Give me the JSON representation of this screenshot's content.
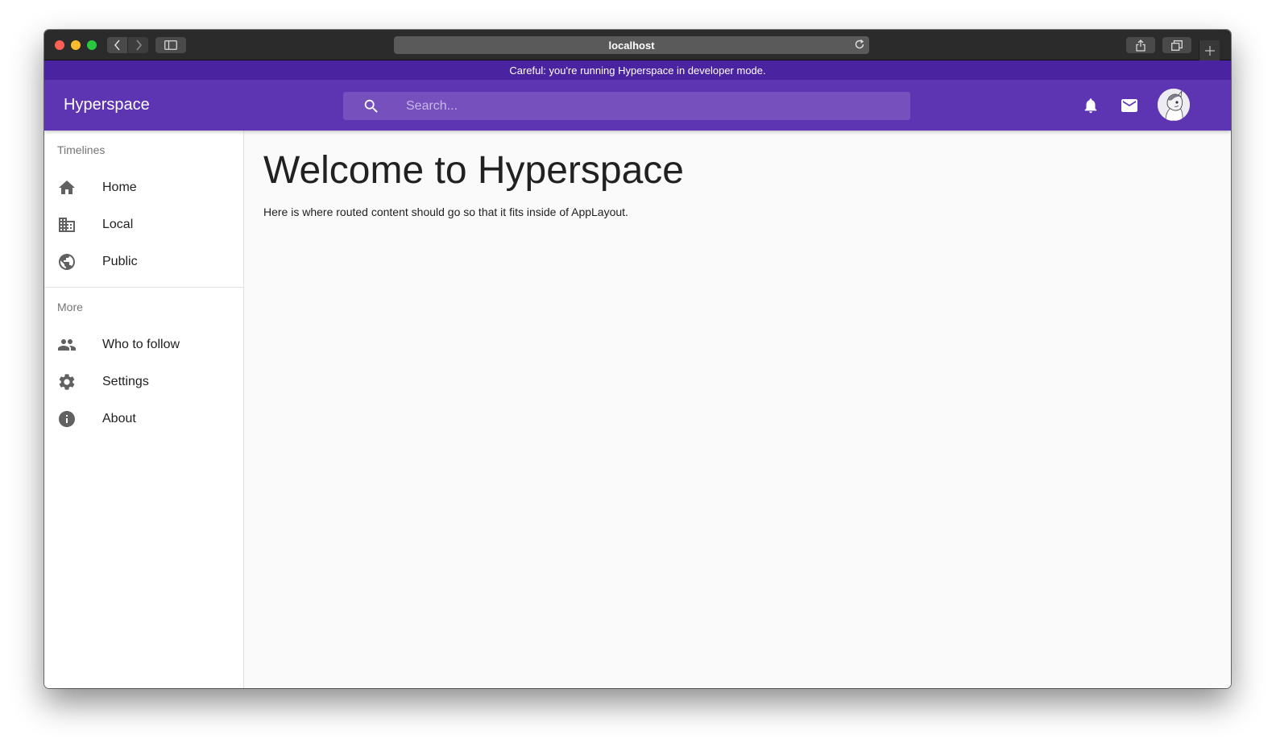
{
  "browser": {
    "url": "localhost"
  },
  "dev_banner": "Careful: you're running Hyperspace in developer mode.",
  "appbar": {
    "brand": "Hyperspace",
    "search_placeholder": "Search..."
  },
  "sidebar": {
    "sections": [
      {
        "title": "Timelines",
        "items": [
          {
            "label": "Home",
            "icon": "home-icon"
          },
          {
            "label": "Local",
            "icon": "building-icon"
          },
          {
            "label": "Public",
            "icon": "globe-icon"
          }
        ]
      },
      {
        "title": "More",
        "items": [
          {
            "label": "Who to follow",
            "icon": "people-icon"
          },
          {
            "label": "Settings",
            "icon": "gear-icon"
          },
          {
            "label": "About",
            "icon": "info-icon"
          }
        ]
      }
    ]
  },
  "main": {
    "title": "Welcome to Hyperspace",
    "body": "Here is where routed content should go so that it fits inside of AppLayout."
  },
  "colors": {
    "appbar": "#5d34b2",
    "dev_banner": "#4a23a0",
    "search": "#7651bd"
  }
}
